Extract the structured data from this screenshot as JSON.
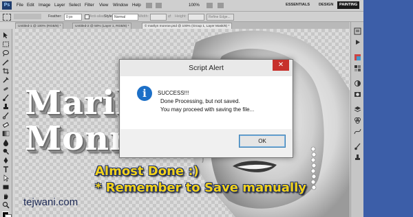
{
  "app": {
    "logo": "Ps",
    "menu": [
      "File",
      "Edit",
      "Image",
      "Layer",
      "Select",
      "Filter",
      "View",
      "Window",
      "Help"
    ],
    "zoom": "100%",
    "workspaces": [
      "ESSENTIALS",
      "DESIGN",
      "PAINTING"
    ]
  },
  "options": {
    "feather_label": "Feather:",
    "feather_value": "0 px",
    "antialias_label": "Anti-alias",
    "style_label": "Style:",
    "style_value": "Normal",
    "width_label": "Width:",
    "height_label": "Height:",
    "refine_label": "Refine Edge..."
  },
  "tabs": [
    "Untitled-1 @ 100% (RGB/8) *",
    "Untitled-2 @ 50% (Layer 1, RGB/8) *",
    "© marilyn monroe.psd @ 100% (Group 1, Layer Mask/8) *"
  ],
  "canvas": {
    "line1": "Marilyn",
    "line2": "Monroe"
  },
  "dialog": {
    "title": "Script Alert",
    "close": "✕",
    "icon": "i",
    "line1": "SUCCESS!!!",
    "line2": "Done Processing, but not saved.",
    "line3": "You may proceed with saving the file...",
    "ok": "OK"
  },
  "overlay": {
    "line1": "Almost Done :)",
    "line2": "* Remember to Save manually"
  },
  "watermark": "tejwani.com",
  "colors": {
    "accent_blue": "#1c6fc7",
    "close_red": "#c7302b",
    "overlay_yellow": "#f2d21a",
    "page_blue": "#3c5ea8"
  }
}
